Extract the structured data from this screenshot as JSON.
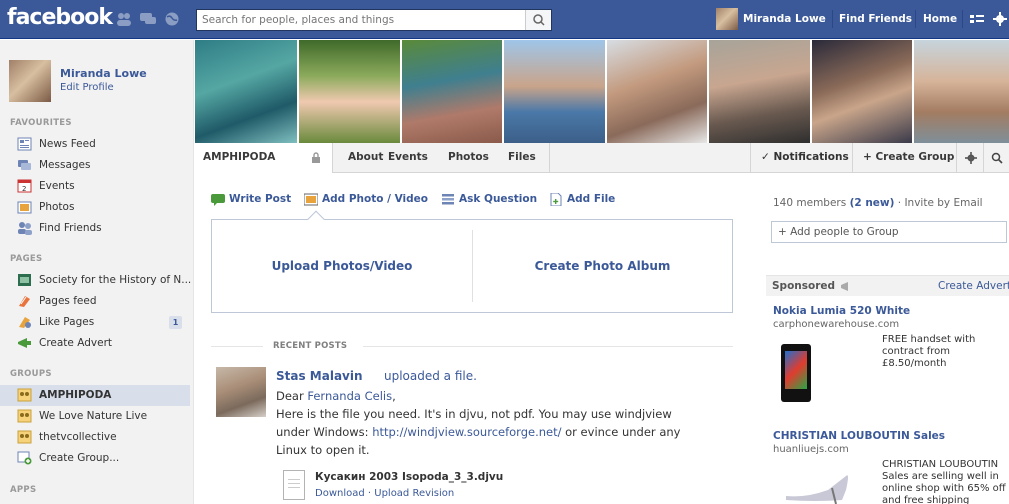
{
  "topbar": {
    "logo": "facebook",
    "search_placeholder": "Search for people, places and things",
    "user_name": "Miranda Lowe",
    "find_friends": "Find Friends",
    "home": "Home",
    "bg_color": "#3b5998"
  },
  "sidebar": {
    "profile_name": "Miranda Lowe",
    "edit_profile": "Edit Profile",
    "favourites_heading": "FAVOURITES",
    "favourites": [
      {
        "label": "News Feed",
        "icon": "news-feed-icon"
      },
      {
        "label": "Messages",
        "icon": "messages-icon"
      },
      {
        "label": "Events",
        "icon": "events-icon"
      },
      {
        "label": "Photos",
        "icon": "photos-icon"
      },
      {
        "label": "Find Friends",
        "icon": "find-friends-icon"
      }
    ],
    "pages_heading": "PAGES",
    "pages": [
      {
        "label": "Society for the History of N...",
        "icon": "page-icon"
      },
      {
        "label": "Pages feed",
        "icon": "pages-feed-icon"
      },
      {
        "label": "Like Pages",
        "icon": "like-pages-icon",
        "count": "1"
      },
      {
        "label": "Create Advert",
        "icon": "create-advert-icon"
      }
    ],
    "groups_heading": "GROUPS",
    "groups": [
      {
        "label": "AMPHIPODA",
        "icon": "group-icon",
        "active": true
      },
      {
        "label": "We Love Nature Live",
        "icon": "group-icon"
      },
      {
        "label": "thetvcollective",
        "icon": "group-icon"
      },
      {
        "label": "Create Group...",
        "icon": "create-group-icon"
      }
    ],
    "apps_heading": "APPS"
  },
  "group_nav": {
    "name": "AMPHIPODA",
    "tabs": [
      "About",
      "Events",
      "Photos",
      "Files"
    ],
    "notifications": "✓ Notifications",
    "create_group": "+ Create Group"
  },
  "composer": {
    "tabs": [
      "Write Post",
      "Add Photo / Video",
      "Ask Question",
      "Add File"
    ],
    "upload": "Upload Photos/Video",
    "create_album": "Create Photo Album"
  },
  "recent_posts_label": "RECENT POSTS",
  "post": {
    "author": "Stas Malavin",
    "action": "uploaded a file.",
    "greeting_prefix": "Dear ",
    "greeting_name": "Fernanda Celis",
    "greeting_suffix": ",",
    "line1": "Here is the file you need. It's in djvu, not pdf. You may use windjview",
    "line2_prefix": "under Windows: ",
    "line2_link": "http://windjview.sourceforge.net/",
    "line2_suffix": " or evince under any",
    "line3": "Linux to open it.",
    "file_name": "Кусакин 2003 Isopoda_3_3.djvu",
    "file_actions": "Download · Upload Revision"
  },
  "right": {
    "members_prefix": "140 members",
    "members_new": "(2 new)",
    "members_invite": " · Invite by Email",
    "add_people": "+ Add people to Group",
    "sponsored": "Sponsored",
    "create_advert": "Create Advert",
    "ads": [
      {
        "title": "Nokia Lumia 520 White",
        "url": "carphonewarehouse.com",
        "text": "FREE handset with contract from £8.50/month"
      },
      {
        "title": "CHRISTIAN LOUBOUTIN Sales",
        "url": "huanliuejs.com",
        "text": "CHRISTIAN LOUBOUTIN Sales are selling well in online shop with 65% off and free shipping"
      }
    ]
  }
}
